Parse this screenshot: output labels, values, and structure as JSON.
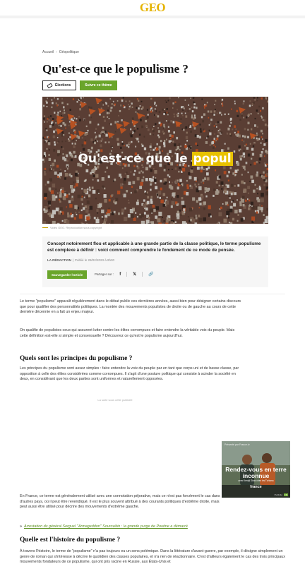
{
  "header": {
    "logo": "GEO"
  },
  "breadcrumb": {
    "home": "Accueil",
    "separator": "›",
    "section": "Géopolitique"
  },
  "article": {
    "title": "Qu'est-ce que le populisme ?",
    "tag": "Élections",
    "follow_label": "Suivre ce thème",
    "hero_caption_main": "Qu'est-ce que le ",
    "hero_caption_highlight": "popul",
    "credit": "Vidéo GEO. Reproduction sous copyright",
    "chapo": "Concept notoirement flou et applicable à une grande partie de la classe politique, le terme populisme est complexe à définir : voici comment comprendre le fondement de ce mode de pensée.",
    "author": "LA RÉDACTION",
    "published": "Publié le 28/02/2023 à 9h30",
    "save_label": "Sauvegarder l'article",
    "share_label": "Partager sur :",
    "share_icons": [
      "facebook-icon",
      "x-icon",
      "link-icon"
    ],
    "paragraphs": {
      "p1": "Le terme \"populisme\" apparaît régulièrement dans le débat public ces dernières années, aussi bien pour désigner certains discours que pour qualifier des personnalités politiques. La montée des mouvements populistes de droite ou de gauche au cours de cette dernière décennie en a fait un enjeu majeur.",
      "p2": "On qualifie de populistes ceux qui assurent lutter contre les élites corrompues et faire entendre la véritable voix du peuple. Mais cette définition est-elle si simple et consensuelle ? Découvrez ce qu'est le populisme aujourd'hui.",
      "h2a": "Quels sont les principes du populisme ?",
      "p3": "Les principes du populisme sont assez simples : faire entendre la voix du peuple par en tant que corps uni et de basse classe, par opposition à celle des élites considérées comme corrompues. Il s'agit d'une posture politique qui consiste à scinder la société en deux, en considérant que les deux parties sont uniformes et naturellement opposées.",
      "ad_label": "La suite sous cette publicité",
      "p4": "En France, ce terme est généralement utilisé avec une connotation péjorative, mais ce n'est pas forcément le cas dans d'autres pays, où il peut être revendiqué. Il est le plus souvent attribué à des courants politiques d'extrême droite, mais peut aussi être utilisé pour décrire des mouvements d'extrême gauche.",
      "related_arrow": "»",
      "related": "Arrestation du général Sergueï \"Armageddon\" Sourovikin : la grande purge de Poutine a démarré",
      "h2b": "Quelle est l'histoire du populisme ?",
      "p5": "À travers l'histoire, le terme de \"populisme\" n'a pas toujours eu un sens polémique. Dans la littérature d'avant-guerre, par exemple, il désigne simplement un genre de roman qui s'intéresse à décrire le quotidien des classes populaires, et n'a rien de réactionnaire. C'est d'ailleurs également le cas des trois principaux mouvements fondateurs de ce populisme, qui ont pris racine en Russie, aux États-Unis et"
    }
  },
  "ad": {
    "head": "Présenté par France.tv",
    "title": "Rendez-vous en terre inconnue",
    "sub": "avec Kendji Girac chez les Turkana",
    "brand": "france",
    "foot": "Publicité",
    "badge": "FR"
  },
  "colors": {
    "accent_green": "#6aa52b",
    "logo_yellow": "#e5b300"
  }
}
